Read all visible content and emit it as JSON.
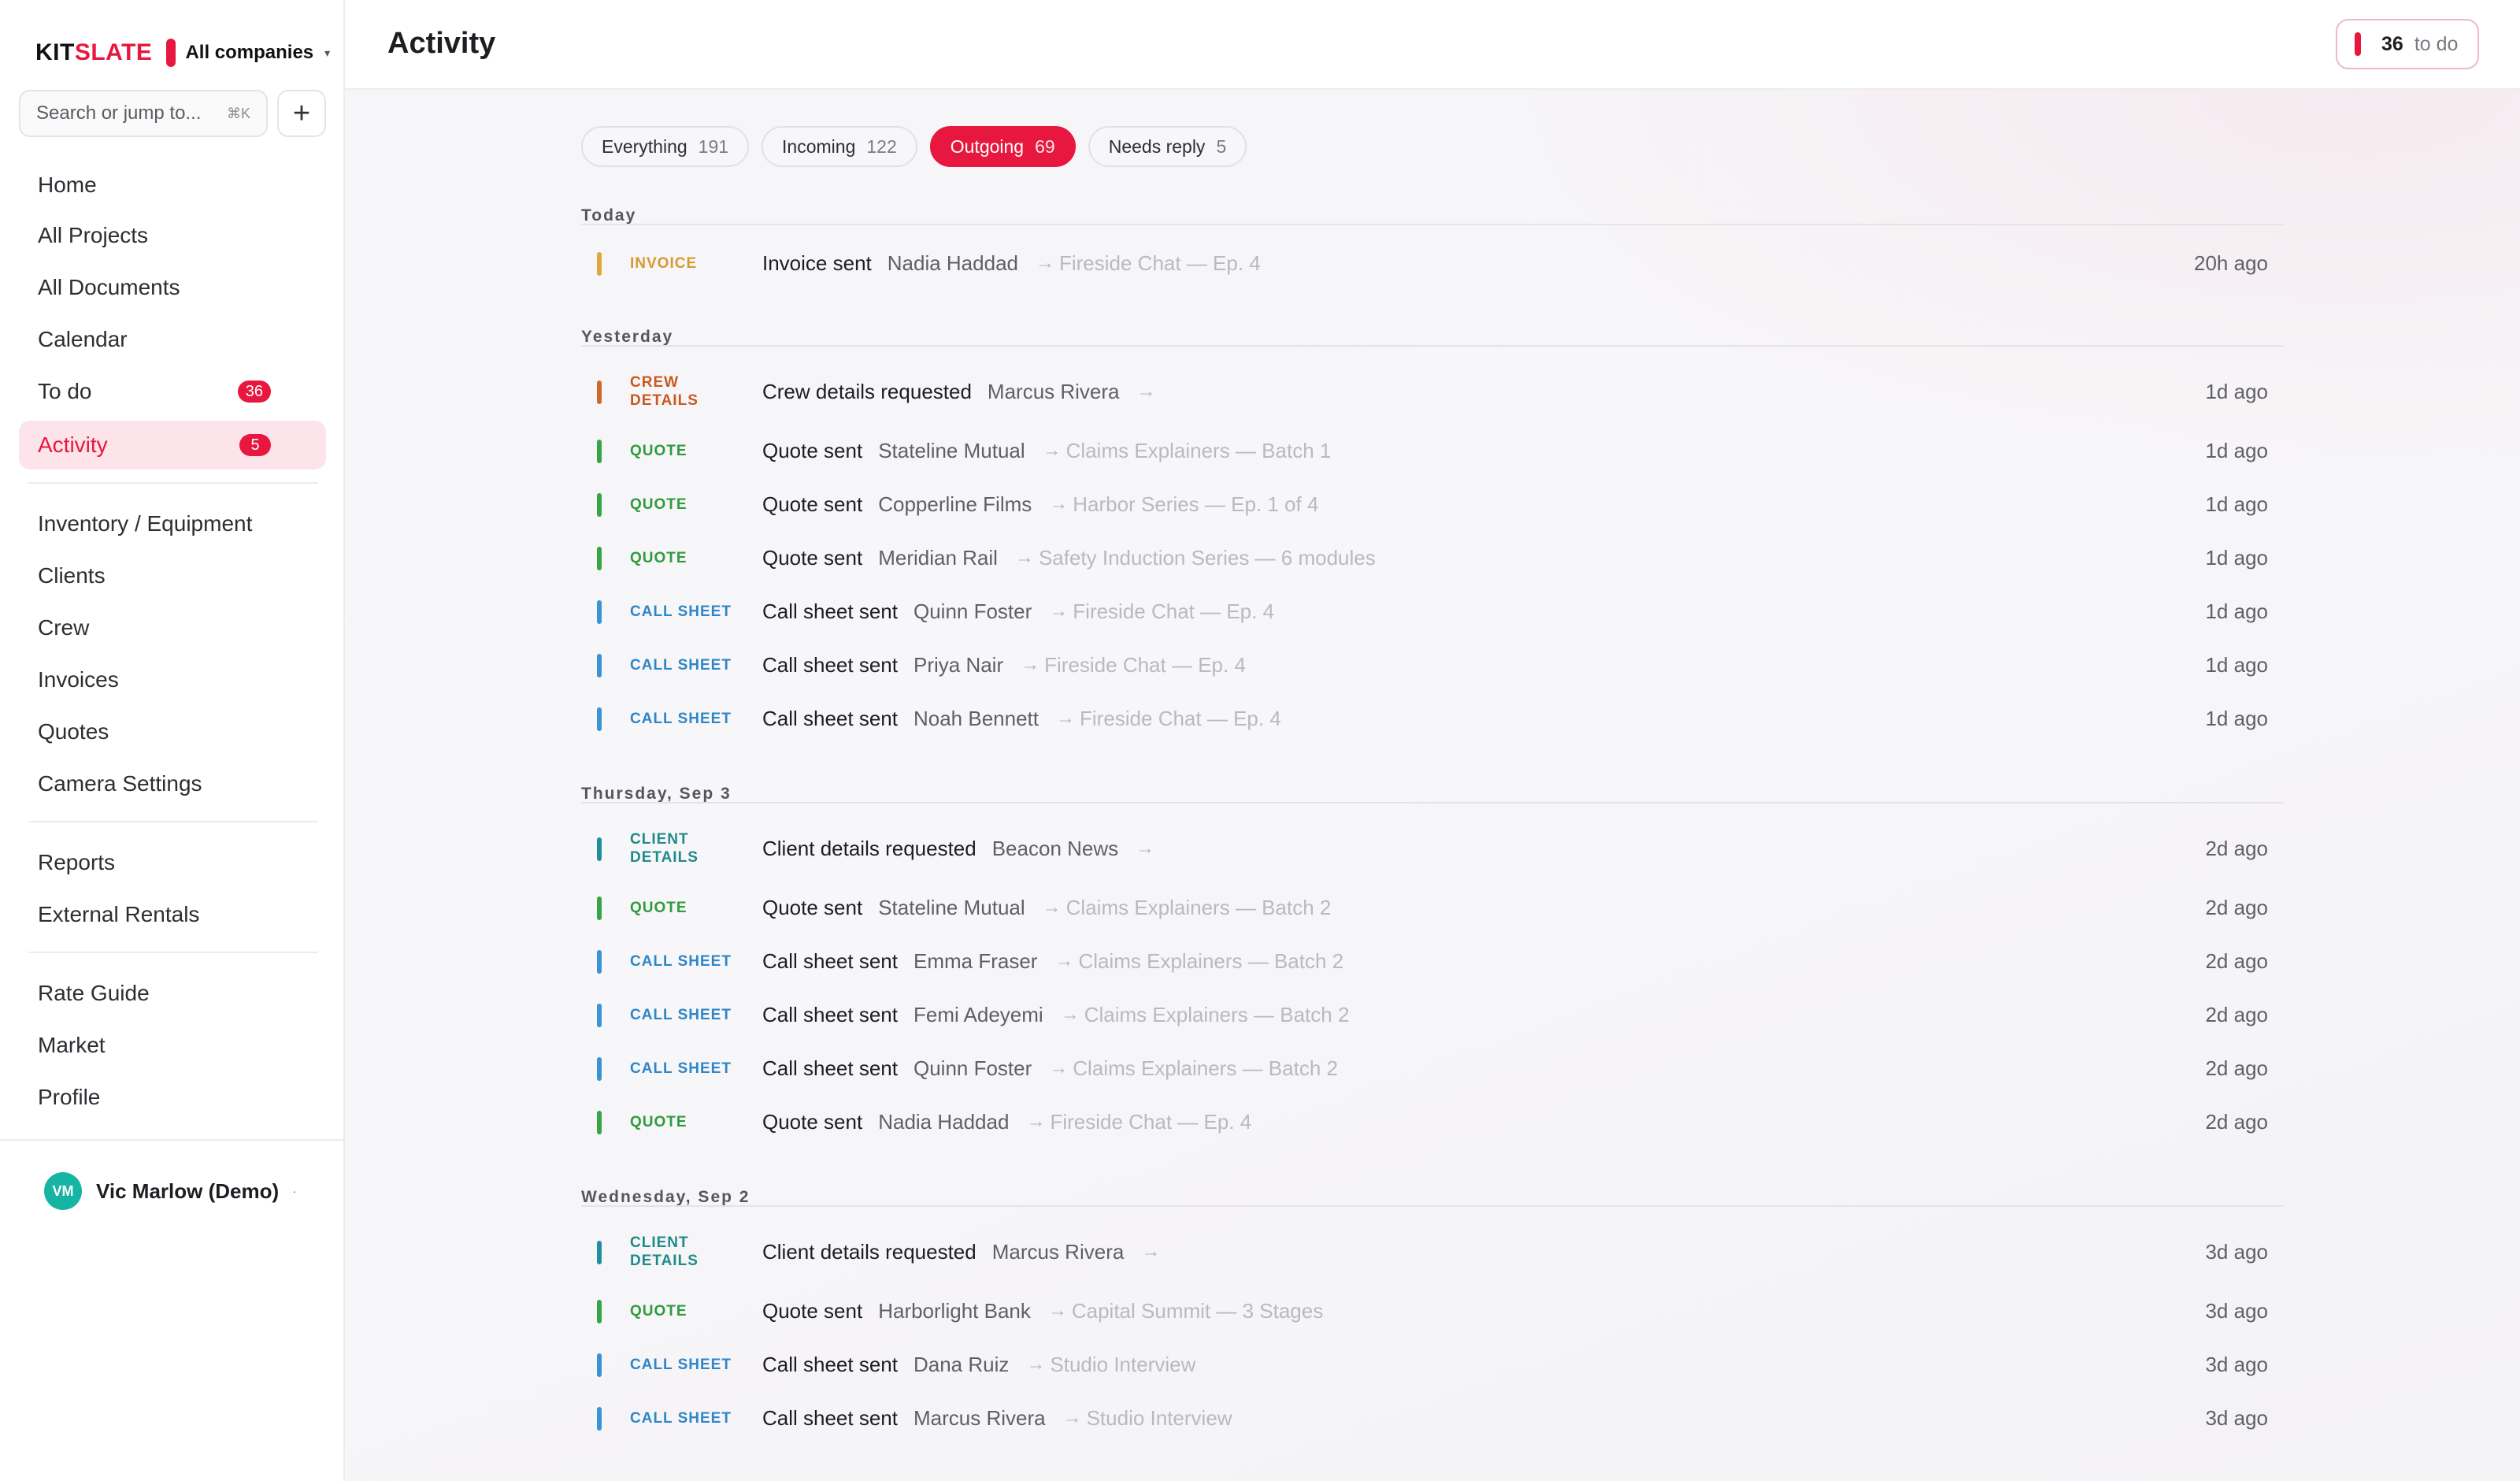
{
  "brand": {
    "name_part1": "KIT",
    "name_part2": "SLATE",
    "company": "All companies",
    "caret": "▾"
  },
  "search": {
    "placeholder": "Search or jump to...",
    "shortcut": "⌘K",
    "add_label": "+"
  },
  "sidebar": {
    "items": [
      {
        "label": "Home"
      },
      {
        "label": "All Projects"
      },
      {
        "label": "All Documents"
      },
      {
        "label": "Calendar"
      },
      {
        "label": "To do",
        "badge": "36"
      },
      {
        "label": "Activity",
        "badge": "5",
        "active": true
      },
      {
        "label": "Inventory / Equipment"
      },
      {
        "label": "Clients"
      },
      {
        "label": "Crew"
      },
      {
        "label": "Invoices"
      },
      {
        "label": "Quotes"
      },
      {
        "label": "Camera Settings"
      },
      {
        "label": "Reports"
      },
      {
        "label": "External Rentals"
      },
      {
        "label": "Rate Guide"
      },
      {
        "label": "Market"
      },
      {
        "label": "Profile"
      }
    ]
  },
  "user": {
    "initials": "VM",
    "name": "Vic Marlow (Demo)",
    "menu_icon": "·"
  },
  "header": {
    "title": "Activity",
    "todo_count": "36",
    "todo_label": "to do"
  },
  "filters": [
    {
      "label": "Everything",
      "count": "191"
    },
    {
      "label": "Incoming",
      "count": "122"
    },
    {
      "label": "Outgoing",
      "count": "69",
      "active": true
    },
    {
      "label": "Needs reply",
      "count": "5"
    }
  ],
  "sections": [
    {
      "title": "Today",
      "rows": [
        {
          "type": "INVOICE",
          "action": "Invoice sent",
          "who": "Nadia Haddad",
          "project": "Fireside Chat — Ep. 4",
          "when": "20h ago"
        }
      ]
    },
    {
      "title": "Yesterday",
      "rows": [
        {
          "type": "CREW DETAILS",
          "action": "Crew details requested",
          "who": "Marcus Rivera",
          "project": "",
          "when": "1d ago"
        },
        {
          "type": "QUOTE",
          "action": "Quote sent",
          "who": "Stateline Mutual",
          "project": "Claims Explainers — Batch 1",
          "when": "1d ago"
        },
        {
          "type": "QUOTE",
          "action": "Quote sent",
          "who": "Copperline Films",
          "project": "Harbor Series — Ep. 1 of 4",
          "when": "1d ago"
        },
        {
          "type": "QUOTE",
          "action": "Quote sent",
          "who": "Meridian Rail",
          "project": "Safety Induction Series — 6 modules",
          "when": "1d ago"
        },
        {
          "type": "CALL SHEET",
          "action": "Call sheet sent",
          "who": "Quinn Foster",
          "project": "Fireside Chat — Ep. 4",
          "when": "1d ago"
        },
        {
          "type": "CALL SHEET",
          "action": "Call sheet sent",
          "who": "Priya Nair",
          "project": "Fireside Chat — Ep. 4",
          "when": "1d ago"
        },
        {
          "type": "CALL SHEET",
          "action": "Call sheet sent",
          "who": "Noah Bennett",
          "project": "Fireside Chat — Ep. 4",
          "when": "1d ago"
        }
      ]
    },
    {
      "title": "Thursday, Sep 3",
      "rows": [
        {
          "type": "CLIENT DETAILS",
          "action": "Client details requested",
          "who": "Beacon News",
          "project": "",
          "when": "2d ago"
        },
        {
          "type": "QUOTE",
          "action": "Quote sent",
          "who": "Stateline Mutual",
          "project": "Claims Explainers — Batch 2",
          "when": "2d ago"
        },
        {
          "type": "CALL SHEET",
          "action": "Call sheet sent",
          "who": "Emma Fraser",
          "project": "Claims Explainers — Batch 2",
          "when": "2d ago"
        },
        {
          "type": "CALL SHEET",
          "action": "Call sheet sent",
          "who": "Femi Adeyemi",
          "project": "Claims Explainers — Batch 2",
          "when": "2d ago"
        },
        {
          "type": "CALL SHEET",
          "action": "Call sheet sent",
          "who": "Quinn Foster",
          "project": "Claims Explainers — Batch 2",
          "when": "2d ago"
        },
        {
          "type": "QUOTE",
          "action": "Quote sent",
          "who": "Nadia Haddad",
          "project": "Fireside Chat — Ep. 4",
          "when": "2d ago"
        }
      ]
    },
    {
      "title": "Wednesday, Sep 2",
      "rows": [
        {
          "type": "CLIENT DETAILS",
          "action": "Client details requested",
          "who": "Marcus Rivera",
          "project": "",
          "when": "3d ago"
        },
        {
          "type": "QUOTE",
          "action": "Quote sent",
          "who": "Harborlight Bank",
          "project": "Capital Summit — 3 Stages",
          "when": "3d ago"
        },
        {
          "type": "CALL SHEET",
          "action": "Call sheet sent",
          "who": "Dana Ruiz",
          "project": "Studio Interview",
          "when": "3d ago"
        },
        {
          "type": "CALL SHEET",
          "action": "Call sheet sent",
          "who": "Marcus Rivera",
          "project": "Studio Interview",
          "when": "3d ago"
        }
      ]
    }
  ],
  "colors": {
    "accent": "#e8173f",
    "invoice": "#e0a73b",
    "crew": "#d06a2c",
    "quote": "#36a447",
    "call_sheet": "#3a93d4",
    "client": "#1f8fa0"
  }
}
